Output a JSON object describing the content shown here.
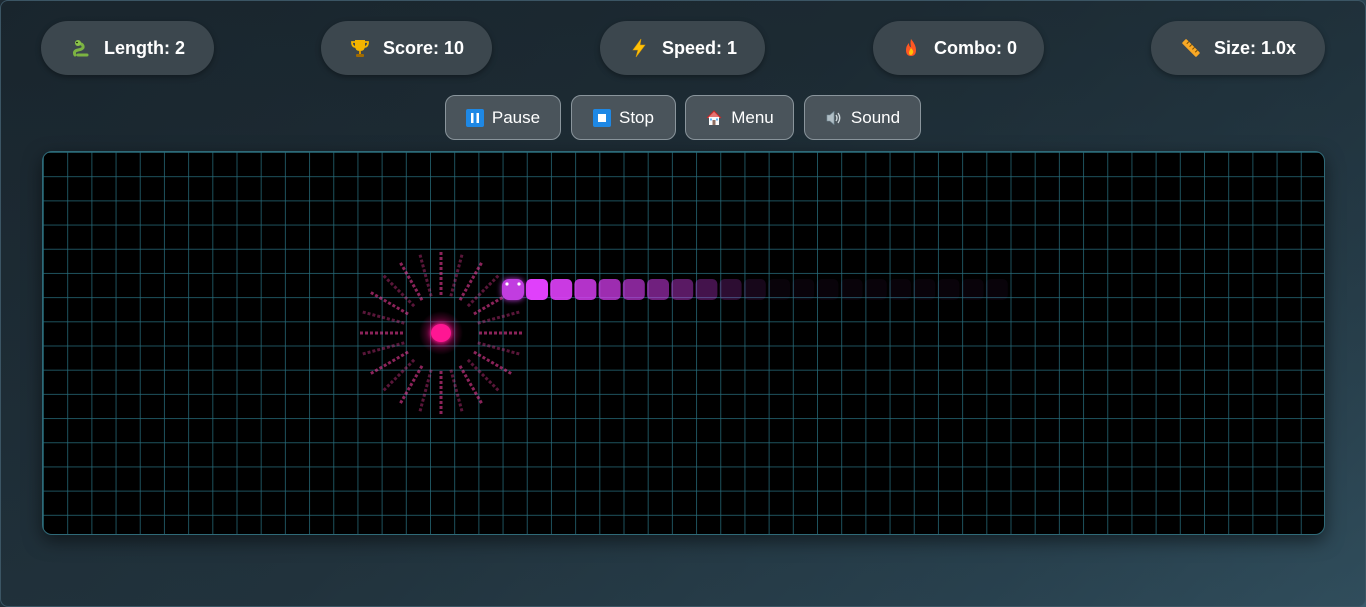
{
  "stats": {
    "length": {
      "label": "Length: 2",
      "icon": "snake-icon"
    },
    "score": {
      "label": "Score: 10",
      "icon": "trophy-icon"
    },
    "speed": {
      "label": "Speed: 1",
      "icon": "lightning-icon"
    },
    "combo": {
      "label": "Combo: 0",
      "icon": "fire-icon"
    },
    "size": {
      "label": "Size: 1.0x",
      "icon": "ruler-icon"
    }
  },
  "controls": {
    "pause": {
      "label": "Pause",
      "icon": "pause-icon"
    },
    "stop": {
      "label": "Stop",
      "icon": "stop-icon"
    },
    "menu": {
      "label": "Menu",
      "icon": "home-icon"
    },
    "sound": {
      "label": "Sound",
      "icon": "speaker-icon"
    }
  },
  "game": {
    "grid_color": "#286e7d",
    "snake_color": "#e040fb",
    "food_color": "#ff1493",
    "board_background": "#000000"
  }
}
